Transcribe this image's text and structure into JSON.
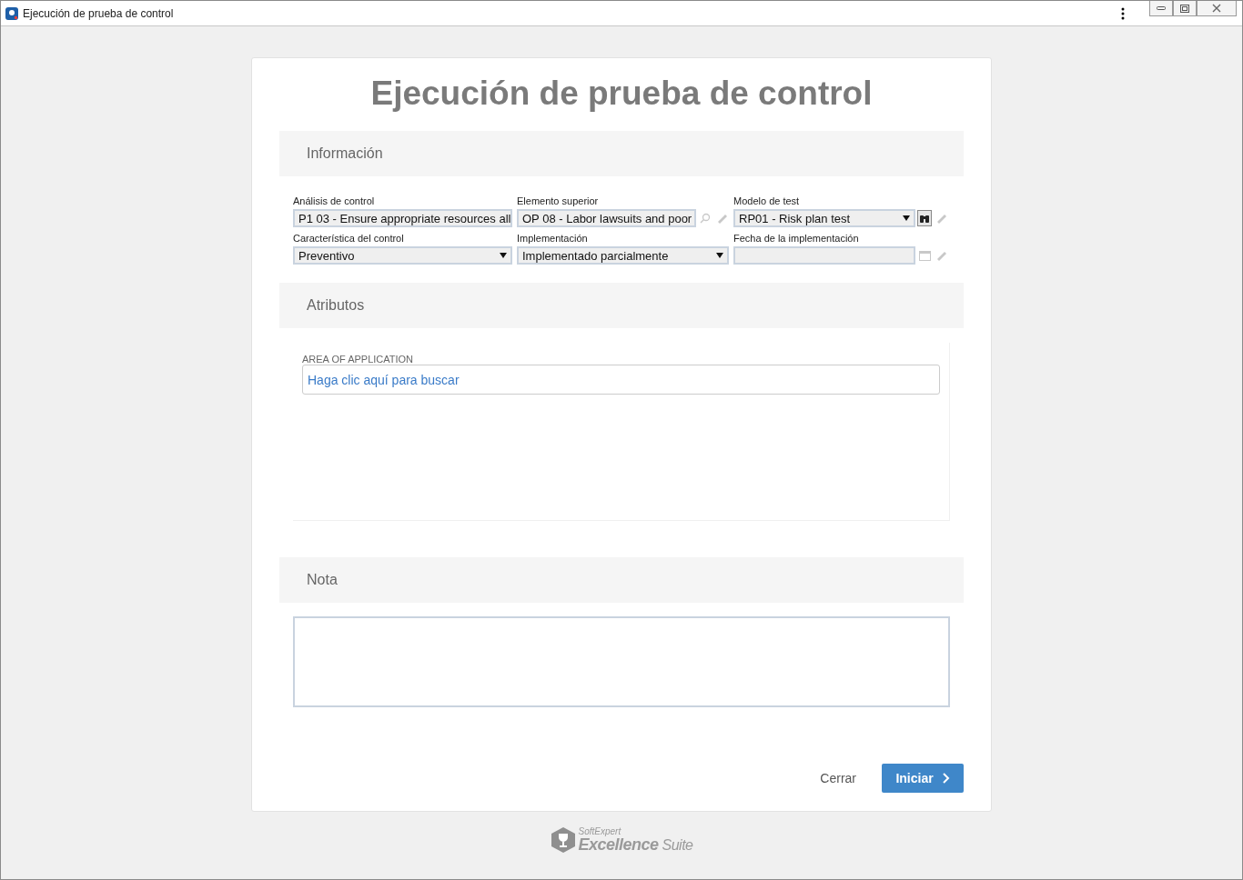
{
  "window": {
    "title": "Ejecución de prueba de control"
  },
  "heading": "Ejecución de prueba de control",
  "sections": [
    {
      "kind": "fields",
      "title": "Información",
      "rows": [
        [
          {
            "kind": "text",
            "label": "Análisis de control",
            "value": "P1 03 - Ensure appropriate resources all"
          },
          {
            "kind": "text",
            "label": "Elemento superior",
            "value": "OP 08 - Labor lawsuits and poor",
            "actions": [
              {
                "kind": "search",
                "disabled": true
              },
              {
                "kind": "clear",
                "disabled": true
              }
            ]
          },
          {
            "kind": "select",
            "label": "Modelo de test",
            "value": "RP01 - Risk plan test",
            "actions": [
              {
                "kind": "binoculars",
                "disabled": false
              },
              {
                "kind": "clear",
                "disabled": true
              }
            ]
          }
        ],
        [
          {
            "kind": "select",
            "label": "Característica del control",
            "value": "Preventivo"
          },
          {
            "kind": "select",
            "label": "Implementación",
            "value": "Implementado parcialmente"
          },
          {
            "kind": "date",
            "label": "Fecha de la implementación",
            "actions": [
              {
                "kind": "calendar",
                "disabled": true
              },
              {
                "kind": "clear",
                "disabled": true
              }
            ]
          }
        ]
      ]
    },
    {
      "kind": "attributes",
      "title": "Atributos",
      "attribute": {
        "label": "AREA OF APPLICATION",
        "placeholder": "Haga clic aquí para buscar"
      }
    },
    {
      "kind": "note",
      "title": "Nota"
    }
  ],
  "buttons": [
    {
      "kind": "link",
      "label": "Cerrar"
    },
    {
      "kind": "primary",
      "label": "Iniciar"
    }
  ],
  "footer_logo": {
    "small": "SoftExpert",
    "main": "Excellence",
    "suffix": "Suite"
  }
}
